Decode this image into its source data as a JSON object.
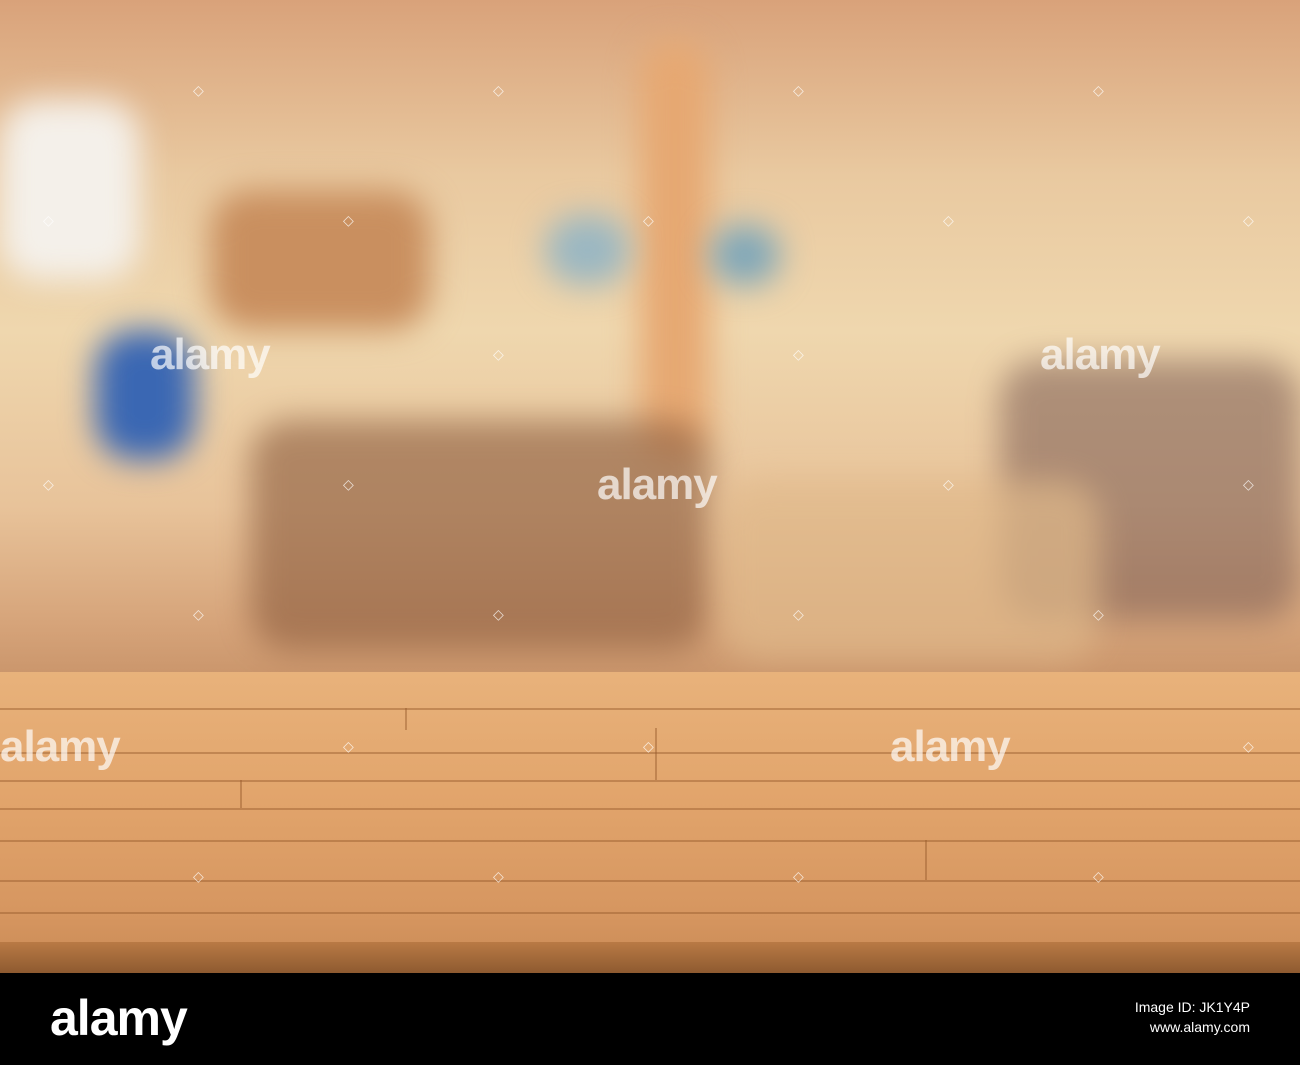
{
  "photo": {
    "subject": "empty-wood-table",
    "colors": {
      "wood": "#e2a56c",
      "background": "#e8c39a"
    }
  },
  "watermark": {
    "word": "alamy",
    "mark": "◇"
  },
  "footer": {
    "logo": "alamy",
    "image_id": "Image ID: JK1Y4P",
    "site": "www.alamy.com"
  }
}
